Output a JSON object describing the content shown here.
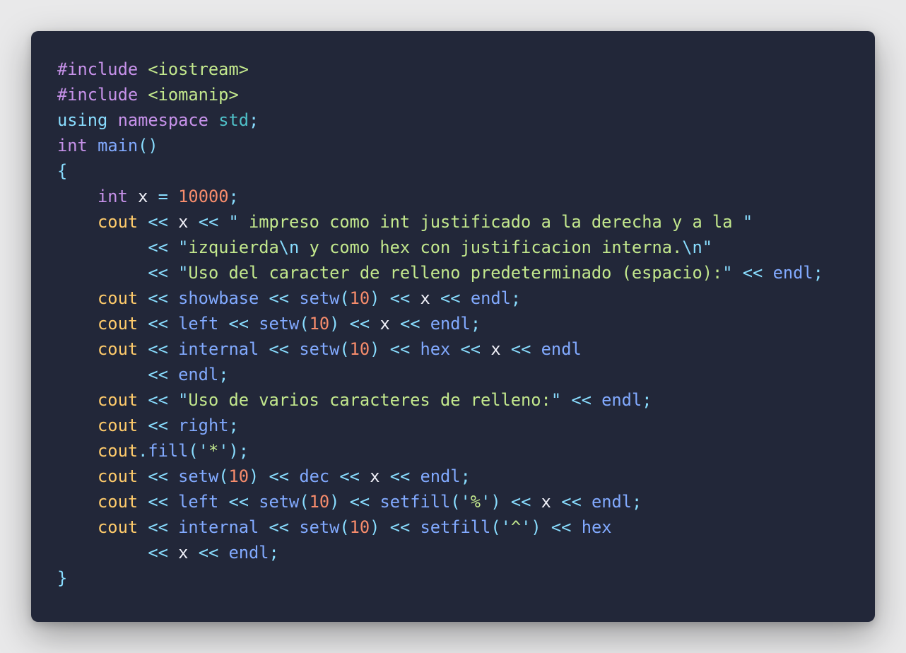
{
  "colors": {
    "background": "#e9e9ea",
    "panel": "#222739",
    "keyword": "#c792ea",
    "string": "#c3e88d",
    "number": "#f78c6c",
    "cout": "#ffcb6b",
    "function": "#82aaff",
    "operator": "#89ddff",
    "variable": "#f0f0f8"
  },
  "code": {
    "language": "C++",
    "lines": [
      [
        {
          "t": "#include",
          "c": "include-kw"
        },
        {
          "t": " ",
          "c": "plain"
        },
        {
          "t": "<iostream>",
          "c": "header"
        }
      ],
      [
        {
          "t": "#include",
          "c": "include-kw"
        },
        {
          "t": " ",
          "c": "plain"
        },
        {
          "t": "<iomanip>",
          "c": "header"
        }
      ],
      [
        {
          "t": "using",
          "c": "using"
        },
        {
          "t": " ",
          "c": "plain"
        },
        {
          "t": "namespace",
          "c": "ns"
        },
        {
          "t": " ",
          "c": "plain"
        },
        {
          "t": "std",
          "c": "std"
        },
        {
          "t": ";",
          "c": "punct"
        }
      ],
      [
        {
          "t": "int",
          "c": "type"
        },
        {
          "t": " ",
          "c": "plain"
        },
        {
          "t": "main",
          "c": "func"
        },
        {
          "t": "()",
          "c": "punct"
        }
      ],
      [
        {
          "t": "{",
          "c": "brace"
        }
      ],
      [
        {
          "t": "    ",
          "c": "plain"
        },
        {
          "t": "int",
          "c": "type"
        },
        {
          "t": " ",
          "c": "plain"
        },
        {
          "t": "x",
          "c": "var"
        },
        {
          "t": " ",
          "c": "plain"
        },
        {
          "t": "=",
          "c": "op"
        },
        {
          "t": " ",
          "c": "plain"
        },
        {
          "t": "10000",
          "c": "number"
        },
        {
          "t": ";",
          "c": "punct"
        }
      ],
      [
        {
          "t": "    ",
          "c": "plain"
        },
        {
          "t": "cout",
          "c": "cout"
        },
        {
          "t": " ",
          "c": "plain"
        },
        {
          "t": "<<",
          "c": "op"
        },
        {
          "t": " ",
          "c": "plain"
        },
        {
          "t": "x",
          "c": "var"
        },
        {
          "t": " ",
          "c": "plain"
        },
        {
          "t": "<<",
          "c": "op"
        },
        {
          "t": " ",
          "c": "plain"
        },
        {
          "t": "\"",
          "c": "punct"
        },
        {
          "t": " impreso como int justificado a la derecha y a la ",
          "c": "string"
        },
        {
          "t": "\"",
          "c": "punct"
        }
      ],
      [
        {
          "t": "         ",
          "c": "plain"
        },
        {
          "t": "<<",
          "c": "op"
        },
        {
          "t": " ",
          "c": "plain"
        },
        {
          "t": "\"",
          "c": "punct"
        },
        {
          "t": "izquierda",
          "c": "string"
        },
        {
          "t": "\\n",
          "c": "escape"
        },
        {
          "t": " y como hex con justificacion interna.",
          "c": "string"
        },
        {
          "t": "\\n",
          "c": "escape"
        },
        {
          "t": "\"",
          "c": "punct"
        }
      ],
      [
        {
          "t": "         ",
          "c": "plain"
        },
        {
          "t": "<<",
          "c": "op"
        },
        {
          "t": " ",
          "c": "plain"
        },
        {
          "t": "\"",
          "c": "punct"
        },
        {
          "t": "Uso del caracter de relleno predeterminado (espacio):",
          "c": "string"
        },
        {
          "t": "\"",
          "c": "punct"
        },
        {
          "t": " ",
          "c": "plain"
        },
        {
          "t": "<<",
          "c": "op"
        },
        {
          "t": " ",
          "c": "plain"
        },
        {
          "t": "endl",
          "c": "manip"
        },
        {
          "t": ";",
          "c": "punct"
        }
      ],
      [
        {
          "t": "    ",
          "c": "plain"
        },
        {
          "t": "cout",
          "c": "cout"
        },
        {
          "t": " ",
          "c": "plain"
        },
        {
          "t": "<<",
          "c": "op"
        },
        {
          "t": " ",
          "c": "plain"
        },
        {
          "t": "showbase",
          "c": "manip"
        },
        {
          "t": " ",
          "c": "plain"
        },
        {
          "t": "<<",
          "c": "op"
        },
        {
          "t": " ",
          "c": "plain"
        },
        {
          "t": "setw",
          "c": "manip"
        },
        {
          "t": "(",
          "c": "punct"
        },
        {
          "t": "10",
          "c": "number"
        },
        {
          "t": ")",
          "c": "punct"
        },
        {
          "t": " ",
          "c": "plain"
        },
        {
          "t": "<<",
          "c": "op"
        },
        {
          "t": " ",
          "c": "plain"
        },
        {
          "t": "x",
          "c": "var"
        },
        {
          "t": " ",
          "c": "plain"
        },
        {
          "t": "<<",
          "c": "op"
        },
        {
          "t": " ",
          "c": "plain"
        },
        {
          "t": "endl",
          "c": "manip"
        },
        {
          "t": ";",
          "c": "punct"
        }
      ],
      [
        {
          "t": "    ",
          "c": "plain"
        },
        {
          "t": "cout",
          "c": "cout"
        },
        {
          "t": " ",
          "c": "plain"
        },
        {
          "t": "<<",
          "c": "op"
        },
        {
          "t": " ",
          "c": "plain"
        },
        {
          "t": "left",
          "c": "manip"
        },
        {
          "t": " ",
          "c": "plain"
        },
        {
          "t": "<<",
          "c": "op"
        },
        {
          "t": " ",
          "c": "plain"
        },
        {
          "t": "setw",
          "c": "manip"
        },
        {
          "t": "(",
          "c": "punct"
        },
        {
          "t": "10",
          "c": "number"
        },
        {
          "t": ")",
          "c": "punct"
        },
        {
          "t": " ",
          "c": "plain"
        },
        {
          "t": "<<",
          "c": "op"
        },
        {
          "t": " ",
          "c": "plain"
        },
        {
          "t": "x",
          "c": "var"
        },
        {
          "t": " ",
          "c": "plain"
        },
        {
          "t": "<<",
          "c": "op"
        },
        {
          "t": " ",
          "c": "plain"
        },
        {
          "t": "endl",
          "c": "manip"
        },
        {
          "t": ";",
          "c": "punct"
        }
      ],
      [
        {
          "t": "    ",
          "c": "plain"
        },
        {
          "t": "cout",
          "c": "cout"
        },
        {
          "t": " ",
          "c": "plain"
        },
        {
          "t": "<<",
          "c": "op"
        },
        {
          "t": " ",
          "c": "plain"
        },
        {
          "t": "internal",
          "c": "manip"
        },
        {
          "t": " ",
          "c": "plain"
        },
        {
          "t": "<<",
          "c": "op"
        },
        {
          "t": " ",
          "c": "plain"
        },
        {
          "t": "setw",
          "c": "manip"
        },
        {
          "t": "(",
          "c": "punct"
        },
        {
          "t": "10",
          "c": "number"
        },
        {
          "t": ")",
          "c": "punct"
        },
        {
          "t": " ",
          "c": "plain"
        },
        {
          "t": "<<",
          "c": "op"
        },
        {
          "t": " ",
          "c": "plain"
        },
        {
          "t": "hex",
          "c": "manip"
        },
        {
          "t": " ",
          "c": "plain"
        },
        {
          "t": "<<",
          "c": "op"
        },
        {
          "t": " ",
          "c": "plain"
        },
        {
          "t": "x",
          "c": "var"
        },
        {
          "t": " ",
          "c": "plain"
        },
        {
          "t": "<<",
          "c": "op"
        },
        {
          "t": " ",
          "c": "plain"
        },
        {
          "t": "endl",
          "c": "manip"
        }
      ],
      [
        {
          "t": "         ",
          "c": "plain"
        },
        {
          "t": "<<",
          "c": "op"
        },
        {
          "t": " ",
          "c": "plain"
        },
        {
          "t": "endl",
          "c": "manip"
        },
        {
          "t": ";",
          "c": "punct"
        }
      ],
      [
        {
          "t": "    ",
          "c": "plain"
        },
        {
          "t": "cout",
          "c": "cout"
        },
        {
          "t": " ",
          "c": "plain"
        },
        {
          "t": "<<",
          "c": "op"
        },
        {
          "t": " ",
          "c": "plain"
        },
        {
          "t": "\"",
          "c": "punct"
        },
        {
          "t": "Uso de varios caracteres de relleno:",
          "c": "string"
        },
        {
          "t": "\"",
          "c": "punct"
        },
        {
          "t": " ",
          "c": "plain"
        },
        {
          "t": "<<",
          "c": "op"
        },
        {
          "t": " ",
          "c": "plain"
        },
        {
          "t": "endl",
          "c": "manip"
        },
        {
          "t": ";",
          "c": "punct"
        }
      ],
      [
        {
          "t": "    ",
          "c": "plain"
        },
        {
          "t": "cout",
          "c": "cout"
        },
        {
          "t": " ",
          "c": "plain"
        },
        {
          "t": "<<",
          "c": "op"
        },
        {
          "t": " ",
          "c": "plain"
        },
        {
          "t": "right",
          "c": "manip"
        },
        {
          "t": ";",
          "c": "punct"
        }
      ],
      [
        {
          "t": "    ",
          "c": "plain"
        },
        {
          "t": "cout",
          "c": "cout"
        },
        {
          "t": ".",
          "c": "punct"
        },
        {
          "t": "fill",
          "c": "manip"
        },
        {
          "t": "(",
          "c": "punct"
        },
        {
          "t": "'",
          "c": "punct"
        },
        {
          "t": "*",
          "c": "string"
        },
        {
          "t": "'",
          "c": "punct"
        },
        {
          "t": ");",
          "c": "punct"
        }
      ],
      [
        {
          "t": "    ",
          "c": "plain"
        },
        {
          "t": "cout",
          "c": "cout"
        },
        {
          "t": " ",
          "c": "plain"
        },
        {
          "t": "<<",
          "c": "op"
        },
        {
          "t": " ",
          "c": "plain"
        },
        {
          "t": "setw",
          "c": "manip"
        },
        {
          "t": "(",
          "c": "punct"
        },
        {
          "t": "10",
          "c": "number"
        },
        {
          "t": ")",
          "c": "punct"
        },
        {
          "t": " ",
          "c": "plain"
        },
        {
          "t": "<<",
          "c": "op"
        },
        {
          "t": " ",
          "c": "plain"
        },
        {
          "t": "dec",
          "c": "manip"
        },
        {
          "t": " ",
          "c": "plain"
        },
        {
          "t": "<<",
          "c": "op"
        },
        {
          "t": " ",
          "c": "plain"
        },
        {
          "t": "x",
          "c": "var"
        },
        {
          "t": " ",
          "c": "plain"
        },
        {
          "t": "<<",
          "c": "op"
        },
        {
          "t": " ",
          "c": "plain"
        },
        {
          "t": "endl",
          "c": "manip"
        },
        {
          "t": ";",
          "c": "punct"
        }
      ],
      [
        {
          "t": "    ",
          "c": "plain"
        },
        {
          "t": "cout",
          "c": "cout"
        },
        {
          "t": " ",
          "c": "plain"
        },
        {
          "t": "<<",
          "c": "op"
        },
        {
          "t": " ",
          "c": "plain"
        },
        {
          "t": "left",
          "c": "manip"
        },
        {
          "t": " ",
          "c": "plain"
        },
        {
          "t": "<<",
          "c": "op"
        },
        {
          "t": " ",
          "c": "plain"
        },
        {
          "t": "setw",
          "c": "manip"
        },
        {
          "t": "(",
          "c": "punct"
        },
        {
          "t": "10",
          "c": "number"
        },
        {
          "t": ")",
          "c": "punct"
        },
        {
          "t": " ",
          "c": "plain"
        },
        {
          "t": "<<",
          "c": "op"
        },
        {
          "t": " ",
          "c": "plain"
        },
        {
          "t": "setfill",
          "c": "manip"
        },
        {
          "t": "(",
          "c": "punct"
        },
        {
          "t": "'",
          "c": "punct"
        },
        {
          "t": "%",
          "c": "string"
        },
        {
          "t": "'",
          "c": "punct"
        },
        {
          "t": ")",
          "c": "punct"
        },
        {
          "t": " ",
          "c": "plain"
        },
        {
          "t": "<<",
          "c": "op"
        },
        {
          "t": " ",
          "c": "plain"
        },
        {
          "t": "x",
          "c": "var"
        },
        {
          "t": " ",
          "c": "plain"
        },
        {
          "t": "<<",
          "c": "op"
        },
        {
          "t": " ",
          "c": "plain"
        },
        {
          "t": "endl",
          "c": "manip"
        },
        {
          "t": ";",
          "c": "punct"
        }
      ],
      [
        {
          "t": "    ",
          "c": "plain"
        },
        {
          "t": "cout",
          "c": "cout"
        },
        {
          "t": " ",
          "c": "plain"
        },
        {
          "t": "<<",
          "c": "op"
        },
        {
          "t": " ",
          "c": "plain"
        },
        {
          "t": "internal",
          "c": "manip"
        },
        {
          "t": " ",
          "c": "plain"
        },
        {
          "t": "<<",
          "c": "op"
        },
        {
          "t": " ",
          "c": "plain"
        },
        {
          "t": "setw",
          "c": "manip"
        },
        {
          "t": "(",
          "c": "punct"
        },
        {
          "t": "10",
          "c": "number"
        },
        {
          "t": ")",
          "c": "punct"
        },
        {
          "t": " ",
          "c": "plain"
        },
        {
          "t": "<<",
          "c": "op"
        },
        {
          "t": " ",
          "c": "plain"
        },
        {
          "t": "setfill",
          "c": "manip"
        },
        {
          "t": "(",
          "c": "punct"
        },
        {
          "t": "'",
          "c": "punct"
        },
        {
          "t": "^",
          "c": "string"
        },
        {
          "t": "'",
          "c": "punct"
        },
        {
          "t": ")",
          "c": "punct"
        },
        {
          "t": " ",
          "c": "plain"
        },
        {
          "t": "<<",
          "c": "op"
        },
        {
          "t": " ",
          "c": "plain"
        },
        {
          "t": "hex",
          "c": "manip"
        }
      ],
      [
        {
          "t": "         ",
          "c": "plain"
        },
        {
          "t": "<<",
          "c": "op"
        },
        {
          "t": " ",
          "c": "plain"
        },
        {
          "t": "x",
          "c": "var"
        },
        {
          "t": " ",
          "c": "plain"
        },
        {
          "t": "<<",
          "c": "op"
        },
        {
          "t": " ",
          "c": "plain"
        },
        {
          "t": "endl",
          "c": "manip"
        },
        {
          "t": ";",
          "c": "punct"
        }
      ],
      [
        {
          "t": "}",
          "c": "brace"
        }
      ]
    ]
  }
}
